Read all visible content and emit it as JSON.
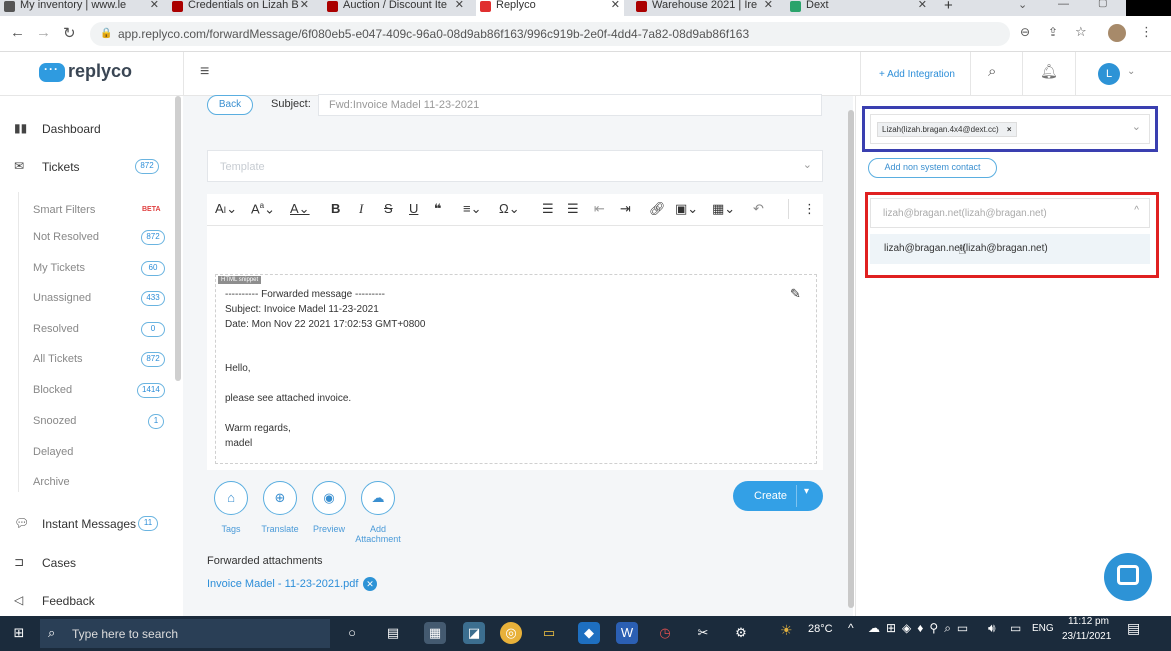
{
  "browser": {
    "tabs": [
      {
        "label": "My inventory | www.le",
        "color": "#555"
      },
      {
        "label": "Credentials on Lizah B",
        "color": "#a00"
      },
      {
        "label": "Auction / Discount Ite",
        "color": "#a00"
      },
      {
        "label": "Replyco",
        "color": "#e03030"
      },
      {
        "label": "Warehouse 2021 | Ire",
        "color": "#a00"
      },
      {
        "label": "Dext",
        "color": "#2aa36b"
      }
    ],
    "new_tab": "+",
    "url": "app.replyco.com/forwardMessage/6f080eb5-e047-409c-96a0-08d9ab86f163/996c919b-2e0f-4dd4-7a82-08d9ab86f163"
  },
  "header": {
    "logo_text": "replyco",
    "add_integration": "+ Add Integration",
    "avatar_letter": "L"
  },
  "sidebar": {
    "dashboard": "Dashboard",
    "tickets": {
      "label": "Tickets",
      "count": "872"
    },
    "sub": [
      {
        "label": "Smart Filters",
        "badge": "BETA"
      },
      {
        "label": "Not Resolved",
        "count": "872"
      },
      {
        "label": "My Tickets",
        "count": "60"
      },
      {
        "label": "Unassigned",
        "count": "433"
      },
      {
        "label": "Resolved",
        "count": "0"
      },
      {
        "label": "All Tickets",
        "count": "872"
      },
      {
        "label": "Blocked",
        "count": "1414"
      },
      {
        "label": "Snoozed",
        "count": "1"
      },
      {
        "label": "Delayed",
        "count": ""
      },
      {
        "label": "Archive",
        "count": ""
      }
    ],
    "instant_messages": {
      "label": "Instant Messages",
      "count": "11"
    },
    "cases": "Cases",
    "feedback": "Feedback"
  },
  "compose": {
    "back": "Back",
    "subject_label": "Subject:",
    "subject_value": "Fwd:Invoice Madel 11-23-2021",
    "template_placeholder": "Template",
    "snippet_tag": "HTML snippet",
    "email_lines": [
      "---------- Forwarded message ---------",
      "Subject: Invoice Madel 11-23-2021",
      "Date: Mon Nov 22 2021 17:02:53 GMT+0800",
      "Hello,",
      "please see attached invoice.",
      "Warm regards,",
      "madel"
    ],
    "actions": [
      {
        "label": "Tags"
      },
      {
        "label": "Translate"
      },
      {
        "label": "Preview"
      },
      {
        "label": "Add Attachment"
      }
    ],
    "create": "Create",
    "fwd_title": "Forwarded attachments",
    "attachment": "Invoice Madel - 11-23-2021.pdf"
  },
  "right": {
    "recipient_chip": "Lizah(lizah.bragan.4x4@dext.cc)",
    "add_non_system": "Add non system contact",
    "dropdown_placeholder": "lizah@bragan.net(lizah@bragan.net)",
    "dropdown_option": "lizah@bragan.net(lizah@bragan.net)",
    "blue_box_color": "#3a3fb0",
    "red_box_color": "#e02020"
  },
  "taskbar": {
    "search_placeholder": "Type here to search",
    "weather": "28°C",
    "lang": "ENG",
    "time": "11:12 pm",
    "date": "23/11/2021"
  }
}
